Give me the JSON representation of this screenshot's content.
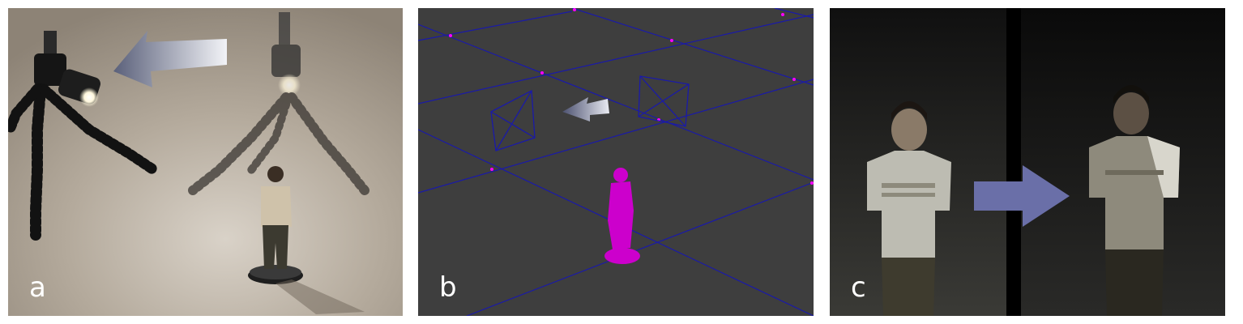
{
  "panels": [
    {
      "label": "a",
      "scene": "photo-miniature-lights"
    },
    {
      "label": "b",
      "scene": "3d-viewport-wireframe"
    },
    {
      "label": "c",
      "scene": "relit-comparison"
    }
  ],
  "colors": {
    "viewport_bg": "#3e3e3e",
    "grid_line": "#1a1aa8",
    "grid_vertex": "#ff00ff",
    "figure_magenta": "#cc00cc",
    "arrow_blue": "#6a6fa8",
    "label_text": "#ffffff"
  }
}
